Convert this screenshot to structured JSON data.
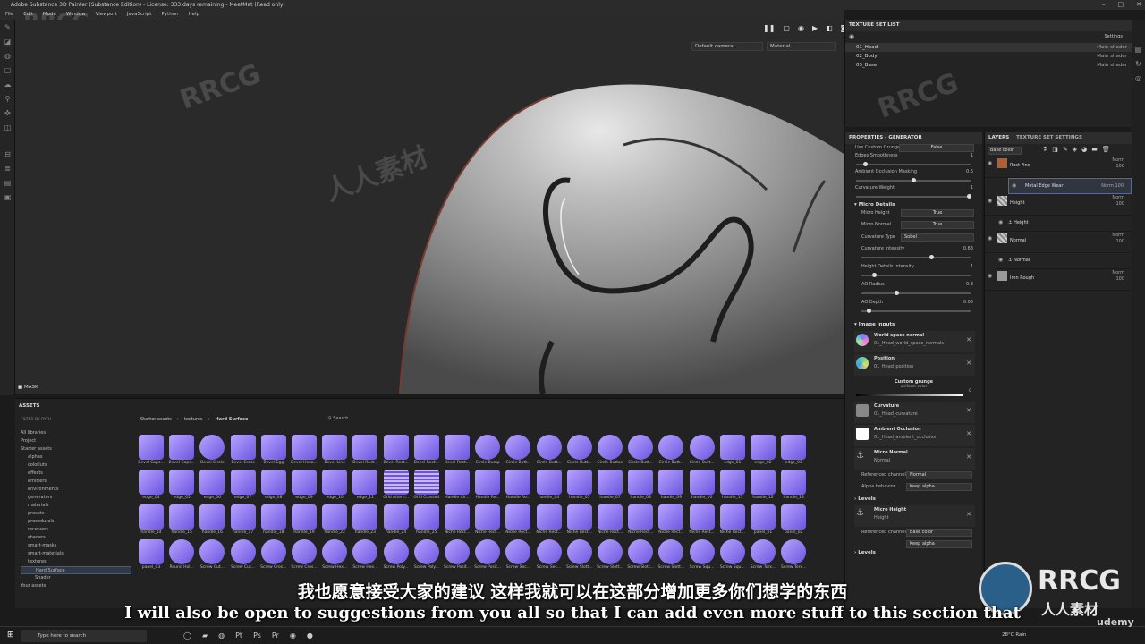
{
  "window": {
    "title": "Adobe Substance 3D Painter (Substance Edition) - License: 333 days remaining - MeetMat (Read only)"
  },
  "menu": [
    "File",
    "Edit",
    "Mode",
    "Window",
    "Viewport",
    "JavaScript",
    "Python",
    "Help"
  ],
  "viewport": {
    "camera": "Default camera",
    "mode": "Material",
    "mask_label": "MASK"
  },
  "texture_set_list": {
    "title": "TEXTURE SET LIST",
    "settings": "Settings",
    "rows": [
      {
        "name": "01_Head",
        "shader": "Main shader"
      },
      {
        "name": "02_Body",
        "shader": "Main shader"
      },
      {
        "name": "03_Base",
        "shader": "Main shader"
      }
    ]
  },
  "properties": {
    "title": "PROPERTIES - GENERATOR",
    "use_custom_grunge": "Use Custom Grunge",
    "use_custom_grunge_value": "False",
    "edges_smoothness": "Edges Smoothness",
    "edges_smoothness_value": "1",
    "ao_masking": "Ambient Occlusion Masking",
    "ao_masking_value": "0.5",
    "curvature_weight": "Curvature Weight",
    "curvature_weight_value": "1",
    "micro_details": "Micro Details",
    "micro_height": "Micro Height",
    "micro_height_value": "True",
    "micro_normal": "Micro Normal",
    "micro_normal_value": "True",
    "curvature_type": "Curvature Type",
    "curvature_type_value": "Sobel",
    "curvature_intensity": "Curvature Intensity",
    "curvature_intensity_value": "0.63",
    "height_details": "Height Details Intensity",
    "height_details_value": "1",
    "ao_radius": "AO Radius",
    "ao_radius_value": "0.3",
    "ao_depth": "AO Depth",
    "ao_depth_value": "0.05",
    "image_inputs": "Image inputs",
    "inputs": [
      {
        "title": "World space normal",
        "sub": "01_Head_world_space_normals"
      },
      {
        "title": "Position",
        "sub": "01_Head_position"
      }
    ],
    "custom_grunge": "Custom grunge",
    "custom_grunge_sub": "uniform color",
    "custom_grunge_value": "0",
    "inputs2": [
      {
        "title": "Curvature",
        "sub": "01_Head_curvature"
      },
      {
        "title": "Ambient Occlusion",
        "sub": "01_Head_ambient_occlusion"
      },
      {
        "title": "Micro Normal",
        "sub": "Normal"
      }
    ],
    "ref_channel": "Referenced channel",
    "ref_channel_value": "Normal",
    "alpha_behavior": "Alpha behavior",
    "alpha_behavior_value": "Keep alpha",
    "levels": "Levels",
    "micro_height_input": "Micro Height",
    "micro_height_input_sub": "Height",
    "ref_channel2_value": "Base color",
    "alpha2_value": "Keep alpha",
    "levels2": "Levels"
  },
  "layers": {
    "tab1": "LAYERS",
    "tab2": "TEXTURE SET SETTINGS",
    "channel": "Base color",
    "rows": [
      {
        "name": "Rust Fine",
        "blend": "Norm",
        "opacity": "100"
      },
      {
        "name": "Metal Edge Wear",
        "blend": "Norm",
        "opacity": "100"
      },
      {
        "name": "Height",
        "blend": "Norm",
        "opacity": "100"
      },
      {
        "name": "Height",
        "blend": "",
        "opacity": ""
      },
      {
        "name": "Normal",
        "blend": "Norm",
        "opacity": "100"
      },
      {
        "name": "Normal",
        "blend": "",
        "opacity": ""
      },
      {
        "name": "Iron Rough",
        "blend": "Norm",
        "opacity": "100"
      }
    ]
  },
  "assets": {
    "title": "ASSETS",
    "filter": "FILTER BY PATH",
    "breadcrumb": [
      "Starter assets",
      "textures",
      "Hard Surface"
    ],
    "search_placeholder": "Search",
    "tree": [
      "All libraries",
      "Project",
      "Starter assets",
      "alphas",
      "colorluts",
      "effects",
      "emitters",
      "environments",
      "generators",
      "materials",
      "presets",
      "procedurals",
      "receivers",
      "shaders",
      "smart-masks",
      "smart-materials",
      "textures",
      "Hard Surface",
      "Shader",
      "Your assets"
    ],
    "items": [
      "Bevel Caps...",
      "Bevel Caps...",
      "Bevel Circle",
      "Bevel Cross",
      "Bevel Egg",
      "Bevel Hexa...",
      "Bevel Line",
      "Bevel Rect...",
      "Bevel Rect...",
      "Bevel Rect...",
      "Bevel Rect...",
      "Circle Bump",
      "Circle Butt...",
      "Circle Butt...",
      "Circle Butt...",
      "Circle Button",
      "Circle Butt...",
      "Circle Butt...",
      "Circle Butt...",
      "edge_01",
      "edge_02",
      "edge_03",
      "edge_04",
      "edge_05",
      "edge_06",
      "edge_07",
      "edge_08",
      "edge_09",
      "edge_10",
      "edge_11",
      "Grid Altern...",
      "Grid Crossed",
      "Handle Cir...",
      "Handle Re...",
      "Handle Re...",
      "handle_04",
      "handle_05",
      "handle_07",
      "handle_08",
      "handle_09",
      "handle_10",
      "handle_11",
      "handle_12",
      "handle_13",
      "handle_14",
      "handle_15",
      "handle_16",
      "handle_17",
      "handle_18",
      "handle_19",
      "handle_22",
      "handle_23",
      "handle_24",
      "handle_25",
      "Niche Rect...",
      "Niche Rect...",
      "Niche Rect...",
      "Niche Rect...",
      "Niche Rect...",
      "Niche Rect...",
      "Niche Rect...",
      "Niche Rect...",
      "Niche Rect...",
      "Niche Rect...",
      "panel_01",
      "panel_02",
      "panel_03",
      "Round Hol...",
      "Screw Cut...",
      "Screw Cut...",
      "Screw Cros...",
      "Screw Cros...",
      "Screw Hex...",
      "Screw Hex...",
      "Screw Poly...",
      "Screw Poly...",
      "Screw Posit...",
      "Screw Posit...",
      "Screw Sec...",
      "Screw Sec...",
      "Screw Slott...",
      "Screw Slott...",
      "Screw Slott...",
      "Screw Slott...",
      "Screw Squ...",
      "Screw Squ...",
      "Screw Torx...",
      "Screw Torx..."
    ]
  },
  "subtitle": {
    "cn": "我也愿意接受大家的建议 这样我就可以在这部分增加更多你们想学的东西",
    "en": "I will also be open to suggestions from you all so that I can add even more stuff to this section that"
  },
  "watermarks": {
    "rrcg": "RRCG",
    "brand": "RRCG",
    "brand_cn": "人人素材",
    "udemy": "udemy"
  },
  "taskbar": {
    "search": "Type here to search",
    "weather": "28°C  Rain",
    "time": "ENG"
  }
}
